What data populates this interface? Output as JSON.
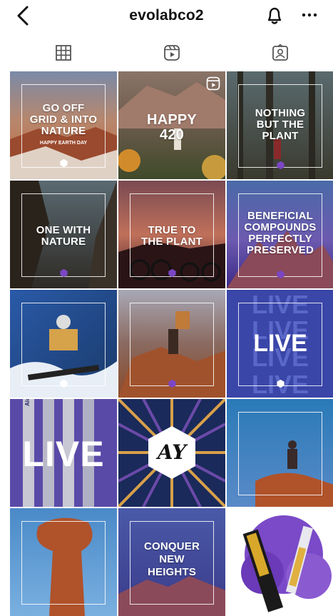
{
  "header": {
    "username": "evolabco2",
    "icons": [
      "back-arrow-icon",
      "bell-icon",
      "more-icon"
    ]
  },
  "tabs": [
    {
      "name": "grid-tab",
      "icon": "grid-icon",
      "selected": true
    },
    {
      "name": "reels-tab",
      "icon": "reels-icon",
      "selected": false
    },
    {
      "name": "tagged-tab",
      "icon": "tagged-icon",
      "selected": false
    }
  ],
  "posts": [
    {
      "line1": "GO OFF",
      "line2": "GRID & INTO",
      "line3": "NATURE",
      "sub": "HAPPY EARTH DAY"
    },
    {
      "line1": "HAPPY",
      "line2": "420",
      "is_reel": true
    },
    {
      "line1": "NOTHING",
      "line2": "BUT THE",
      "line3": "PLANT"
    },
    {
      "line1": "ONE WITH",
      "line2": "NATURE"
    },
    {
      "line1": "TRUE TO",
      "line2": "THE PLANT"
    },
    {
      "line1": "BENEFICIAL",
      "line2": "COMPOUNDS",
      "line3": "PERFECTLY",
      "line4": "PRESERVED"
    },
    {},
    {},
    {
      "bg_word": "LIVE",
      "main": "LIVE"
    },
    {
      "main": "LIVE",
      "tube_label": "Alchemy"
    },
    {
      "logo": "AY"
    },
    {},
    {},
    {
      "line1": "CONQUER",
      "line2": "NEW",
      "line3": "HEIGHTS"
    },
    {}
  ],
  "colors": {
    "text": "#111111",
    "background": "#ffffff"
  }
}
